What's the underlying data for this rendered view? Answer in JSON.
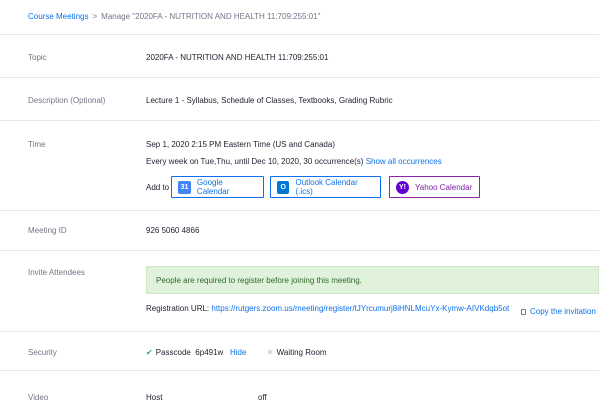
{
  "breadcrumb": {
    "link": "Course Meetings",
    "separator": ">",
    "current": "Manage \"2020FA - NUTRITION AND HEALTH 11:709:255:01\""
  },
  "topic": {
    "label": "Topic",
    "value": "2020FA - NUTRITION AND HEALTH 11:709:255:01"
  },
  "description": {
    "label": "Description (Optional)",
    "value": "Lecture 1 - Syllabus, Schedule of Classes, Textbooks, Grading Rubric"
  },
  "time": {
    "label": "Time",
    "datetime": "Sep 1, 2020 2:15 PM  Eastern Time (US and Canada)",
    "recurrence": "Every week on Tue,Thu, until Dec 10, 2020, 30 occurrence(s)",
    "show_all": "Show all occurrences",
    "add_to": "Add to",
    "google": {
      "label": "Google Calendar",
      "icon_text": "31",
      "color": "#4285f4"
    },
    "outlook": {
      "label": "Outlook Calendar (.ics)",
      "icon_text": "O",
      "color": "#0078d4"
    },
    "yahoo": {
      "label": "Yahoo Calendar",
      "icon_text": "Y!",
      "color": "#6001d2"
    }
  },
  "meeting_id": {
    "label": "Meeting ID",
    "value": "926 5060 4866"
  },
  "invite": {
    "label": "Invite Attendees",
    "notice": "People are required to register before joining this meeting.",
    "reg_label": "Registration URL:",
    "reg_url": "https://rutgers.zoom.us/meeting/register/tJYrcumurj8iHNLMcuYx-Kymw-AIVKdqb5ot",
    "copy": "Copy the invitation"
  },
  "security": {
    "label": "Security",
    "passcode_label": "Passcode",
    "passcode": "6p491w",
    "hide": "Hide",
    "waiting_room": "Waiting Room"
  },
  "video": {
    "label": "Video",
    "host_label": "Host",
    "host_value": "off"
  }
}
